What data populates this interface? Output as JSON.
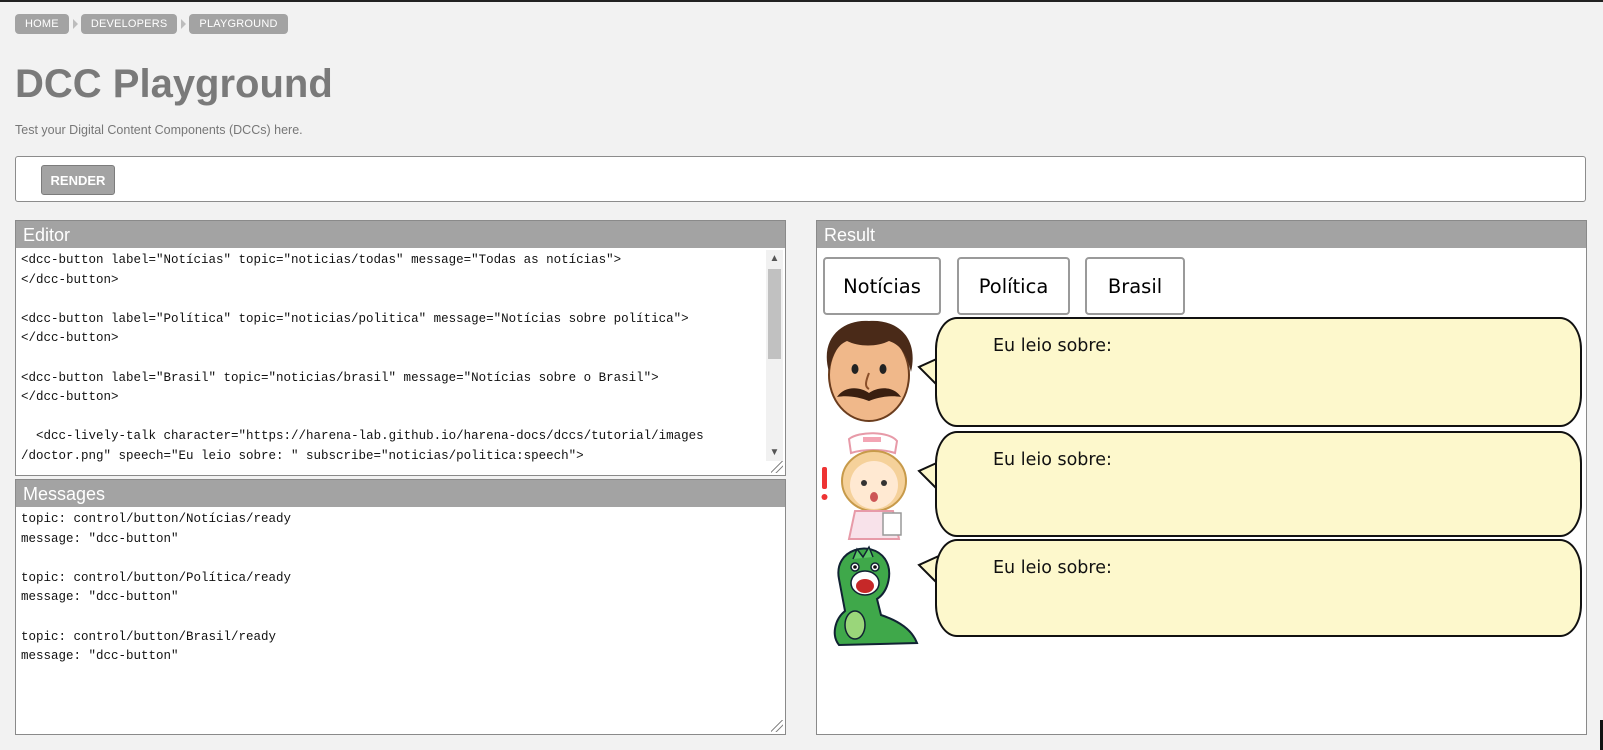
{
  "breadcrumb": [
    "HOME",
    "DEVELOPERS",
    "PLAYGROUND"
  ],
  "page": {
    "title": "DCC Playground",
    "subtitle": "Test your Digital Content Components (DCCs) here."
  },
  "toolbar": {
    "render_label": "RENDER"
  },
  "editor": {
    "title": "Editor",
    "code": "<dcc-button label=\"Notícias\" topic=\"noticias/todas\" message=\"Todas as notícias\">\n</dcc-button>\n\n<dcc-button label=\"Política\" topic=\"noticias/politica\" message=\"Notícias sobre política\">\n</dcc-button>\n\n<dcc-button label=\"Brasil\" topic=\"noticias/brasil\" message=\"Notícias sobre o Brasil\">\n</dcc-button>\n\n  <dcc-lively-talk character=\"https://harena-lab.github.io/harena-docs/dccs/tutorial/images\n/doctor.png\" speech=\"Eu leio sobre: \" subscribe=\"noticias/politica:speech\">"
  },
  "messages": {
    "title": "Messages",
    "log": "topic: control/button/Notícias/ready\nmessage: \"dcc-button\"\n\ntopic: control/button/Política/ready\nmessage: \"dcc-button\"\n\ntopic: control/button/Brasil/ready\nmessage: \"dcc-button\""
  },
  "result": {
    "title": "Result",
    "buttons": [
      "Notícias",
      "Política",
      "Brasil"
    ],
    "talks": [
      {
        "character": "doctor-icon",
        "speech": "Eu leio sobre:"
      },
      {
        "character": "nurse-icon",
        "speech": "Eu leio sobre:"
      },
      {
        "character": "dinosaur-icon",
        "speech": "Eu leio sobre:"
      }
    ]
  },
  "colors": {
    "header_gray": "#a3a3a3",
    "bubble_fill": "#fdf8cc",
    "page_bg": "#f2f2f2"
  }
}
